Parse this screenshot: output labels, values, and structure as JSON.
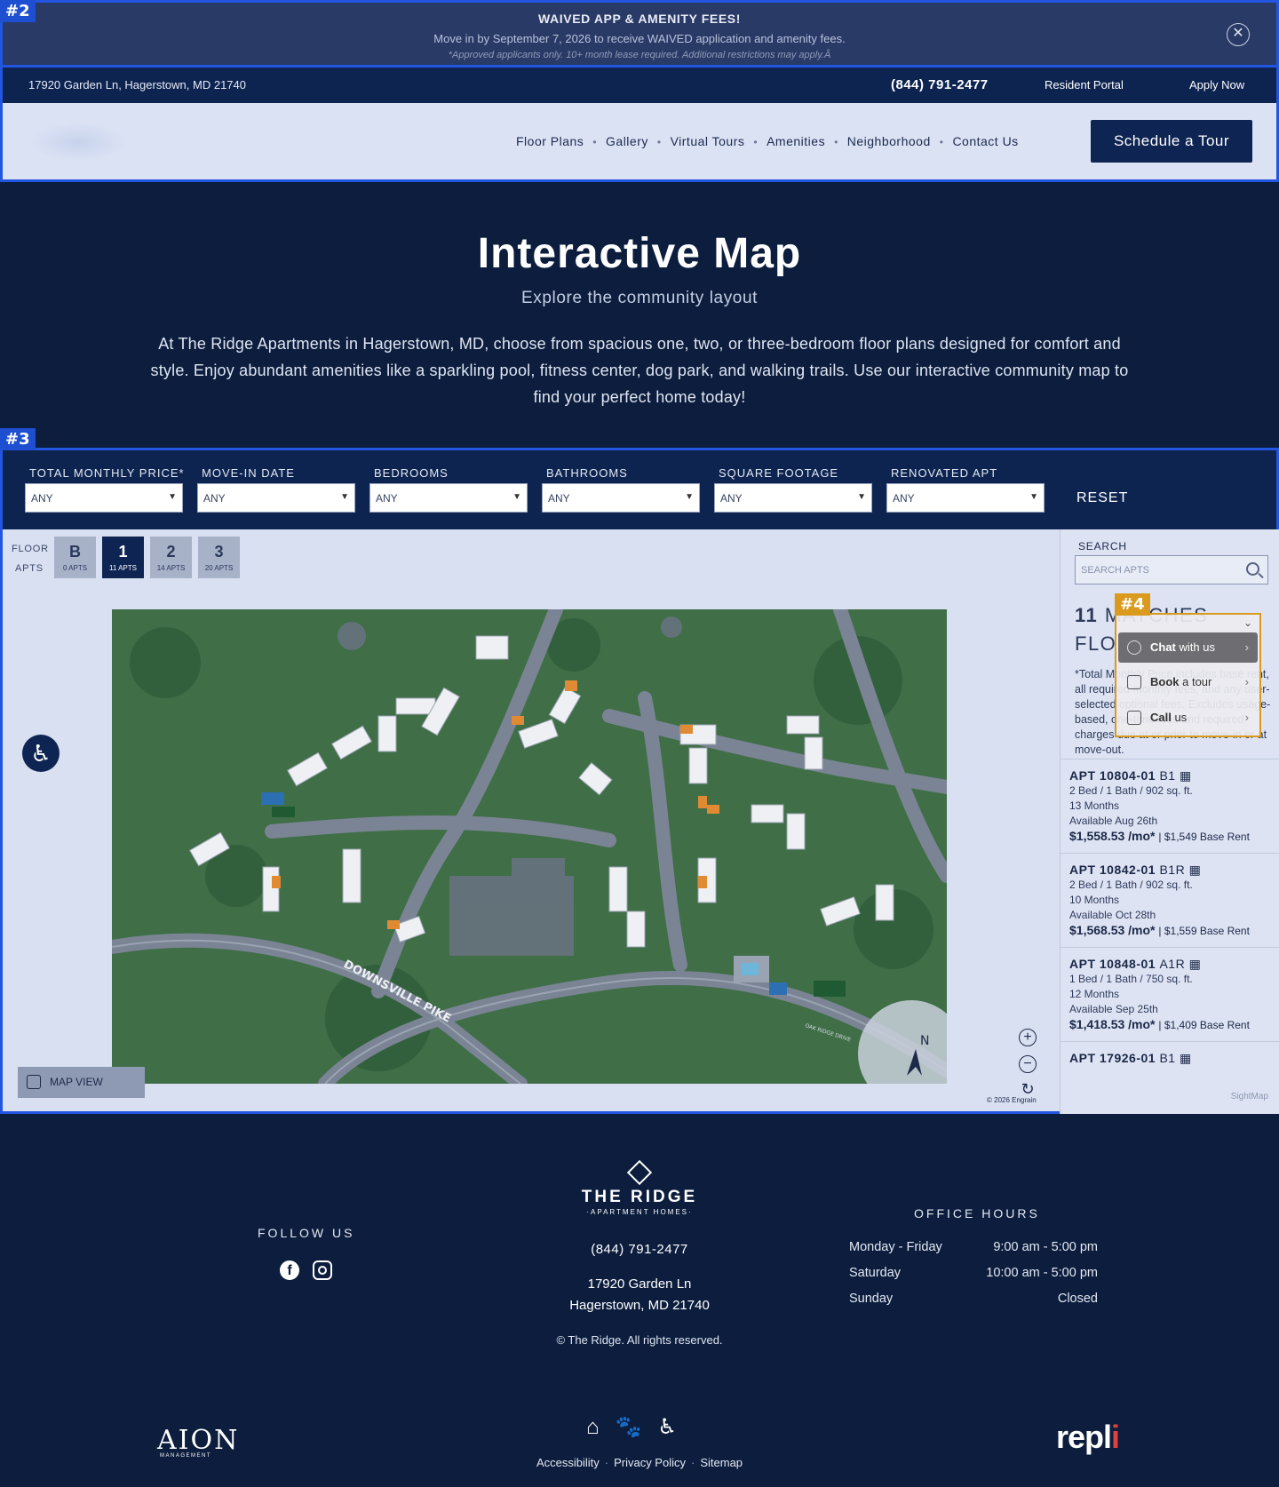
{
  "tags": {
    "banner": "#2",
    "filters": "#3",
    "chat": "#4"
  },
  "banner": {
    "title": "WAIVED APP & AMENITY FEES!",
    "line": "Move in by September 7, 2026 to receive WAIVED application and amenity fees.",
    "fine": "*Approved applicants only. 10+ month lease required. Additional restrictions may apply.Â",
    "close": "✕"
  },
  "topbar": {
    "address": "17920 Garden Ln, Hagerstown, MD 21740",
    "phone": "(844) 791-2477",
    "portal": "Resident Portal",
    "apply": "Apply Now"
  },
  "nav": {
    "links": [
      "Floor Plans",
      "Gallery",
      "Virtual Tours",
      "Amenities",
      "Neighborhood",
      "Contact Us"
    ],
    "separator": "•",
    "cta": "Schedule a Tour"
  },
  "hero": {
    "title": "Interactive Map",
    "subtitle": "Explore the community layout",
    "description": "At The Ridge Apartments in Hagerstown, MD, choose from spacious one, two, or three-bedroom floor plans designed for comfort and style. Enjoy abundant amenities like a sparkling pool, fitness center, dog park, and walking trails. Use our interactive community map to find your perfect home today!"
  },
  "filters": {
    "items": [
      {
        "label": "TOTAL MONTHLY PRICE*",
        "value": "ANY"
      },
      {
        "label": "MOVE-IN DATE",
        "value": "ANY"
      },
      {
        "label": "BEDROOMS",
        "value": "ANY"
      },
      {
        "label": "BATHROOMS",
        "value": "ANY"
      },
      {
        "label": "SQUARE FOOTAGE",
        "value": "ANY"
      },
      {
        "label": "RENOVATED APT",
        "value": "ANY"
      }
    ],
    "reset": "RESET"
  },
  "floors": {
    "floor_label": "FLOOR",
    "apts_label": "APTS",
    "buttons": [
      {
        "name": "B",
        "count": "0 APTS"
      },
      {
        "name": "1",
        "count": "11 APTS",
        "active": true
      },
      {
        "name": "2",
        "count": "14 APTS"
      },
      {
        "name": "3",
        "count": "20 APTS"
      }
    ]
  },
  "map": {
    "road_label": "DOWNSVILLE PIKE",
    "road_label_2": "OAK RIDGE DRIVE",
    "compass": "N",
    "copyright": "© 2026 Engrain",
    "map_view": "MAP VIEW",
    "zoom_in": "+",
    "zoom_out": "−",
    "reset_icon": "↻",
    "accessibility_icon": "♿"
  },
  "sidebar": {
    "search_label": "SEARCH",
    "search_placeholder": "SEARCH APTS",
    "matches_count": "11",
    "matches_text": "MATCHES",
    "floor_text": "FLO",
    "note": "*Total Monthly Price includes base rent, all required monthly fees, and any user-selected optional fees. Excludes usage-based, one-time fees and required charges due at or prior to move-in or at move-out.",
    "apartments": [
      {
        "title": "APT 10804-01",
        "plan": "B1",
        "beds": "2 Bed / 1 Bath / 902 sq. ft.",
        "term": "13 Months",
        "avail": "Available Aug 26th",
        "price": "$1,558.53 /mo*",
        "base": "$1,549 Base Rent"
      },
      {
        "title": "APT 10842-01",
        "plan": "B1R",
        "beds": "2 Bed / 1 Bath / 902 sq. ft.",
        "term": "10 Months",
        "avail": "Available Oct 28th",
        "price": "$1,568.53 /mo*",
        "base": "$1,559 Base Rent"
      },
      {
        "title": "APT 10848-01",
        "plan": "A1R",
        "beds": "1 Bed / 1 Bath / 750 sq. ft.",
        "term": "12 Months",
        "avail": "Available Sep 25th",
        "price": "$1,418.53 /mo*",
        "base": "$1,409 Base Rent"
      },
      {
        "title": "APT 17926-01",
        "plan": "B1"
      }
    ],
    "brand": "SightMap"
  },
  "chat": {
    "items": [
      {
        "bold": "Chat",
        "rest": " with us"
      },
      {
        "bold": "Book",
        "rest": " a tour"
      },
      {
        "bold": "Call",
        "rest": " us"
      }
    ]
  },
  "footer": {
    "follow": "FOLLOW US",
    "brand_name": "THE RIDGE",
    "brand_sub": "·APARTMENT HOMES·",
    "phone": "(844) 791-2477",
    "address1": "17920 Garden Ln",
    "address2": "Hagerstown, MD 21740",
    "rights": "© The Ridge. All rights reserved.",
    "office_hours_title": "OFFICE HOURS",
    "hours": [
      {
        "day": "Monday - Friday",
        "time": "9:00 am - 5:00 pm"
      },
      {
        "day": "Saturday",
        "time": "10:00 am - 5:00 pm"
      },
      {
        "day": "Sunday",
        "time": "Closed"
      }
    ],
    "links": [
      "Accessibility",
      "Privacy Policy",
      "Sitemap"
    ],
    "aion": "AION",
    "aion_sub": "MANAGEMENT",
    "repli": "repl",
    "repli_i": "i"
  }
}
